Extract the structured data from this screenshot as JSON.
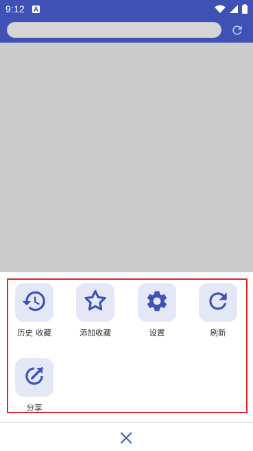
{
  "status_bar": {
    "time": "9:12",
    "notification_icon": "a-notification-icon",
    "wifi_icon": "wifi-icon",
    "cell_icon": "cell-signal-icon",
    "battery_icon": "battery-icon"
  },
  "toolbar": {
    "url_value": "",
    "refresh_icon": "refresh-icon"
  },
  "colors": {
    "primary": "#3f51b5",
    "accent_icon": "#3f51b5",
    "tile_bg": "#e4e8f6",
    "webview_bg": "#cccccc",
    "highlight": "#e3242b"
  },
  "menu": {
    "items": [
      {
        "label": "历史 收藏",
        "icon": "history-icon"
      },
      {
        "label": "添加收藏",
        "icon": "star-icon"
      },
      {
        "label": "设置",
        "icon": "gear-icon"
      },
      {
        "label": "刷新",
        "icon": "refresh-icon"
      },
      {
        "label": "分享",
        "icon": "share-icon"
      }
    ]
  },
  "bottom": {
    "close_icon": "close-icon"
  }
}
